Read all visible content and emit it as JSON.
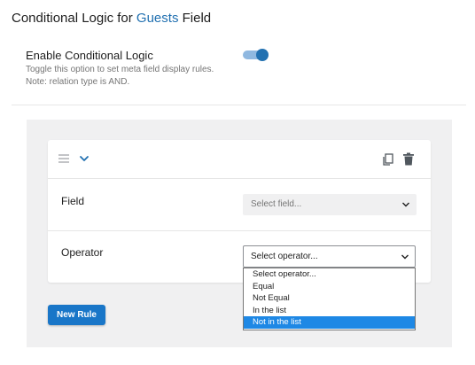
{
  "header": {
    "title_prefix": "Conditional Logic for ",
    "title_accent": "Guests",
    "title_suffix": " Field"
  },
  "enable": {
    "label": "Enable Conditional Logic",
    "help_line1": "Toggle this option to set meta field display rules.",
    "help_line2": "Note: relation type is AND.",
    "enabled": true
  },
  "rule": {
    "field_label": "Field",
    "field_placeholder": "Select field...",
    "operator_label": "Operator",
    "operator_value": "Select operator...",
    "operator_options": [
      "Select operator...",
      "Equal",
      "Not Equal",
      "In the list",
      "Not in the list"
    ],
    "highlighted_option": "Not in the list"
  },
  "actions": {
    "new_rule_label": "New Rule"
  },
  "icons": {
    "drag": "drag-handle-icon",
    "collapse": "chevron-down-icon",
    "copy": "copy-icon",
    "delete": "trash-icon",
    "dropdown": "chevron-down-icon"
  },
  "colors": {
    "accent": "#2271b1",
    "button": "#1976c8",
    "highlight": "#1e88e5"
  }
}
